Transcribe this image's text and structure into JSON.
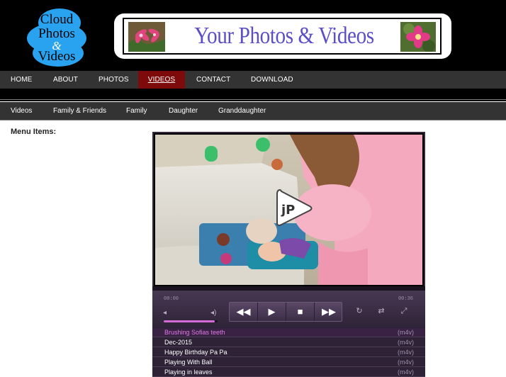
{
  "logo": {
    "line1": "Cloud",
    "line2": "Photos",
    "amp": "&",
    "line3": "Videos"
  },
  "banner": {
    "title": "Your Photos & Videos"
  },
  "nav": {
    "items": [
      "HOME",
      "ABOUT",
      "PHOTOS",
      "VIDEOS",
      "CONTACT",
      "DOWNLOAD"
    ],
    "active": "VIDEOS",
    "active_color": "#7d0b0b"
  },
  "subnav": {
    "items": [
      "Videos",
      "Family & Friends",
      "Family",
      "Daughter",
      "Granddaughter"
    ]
  },
  "menu_label": "Menu Items:",
  "player": {
    "watermark": "jP",
    "time_current": "00:00",
    "time_total": "00:36",
    "volume_level": 0.95,
    "accent_color": "#e07ae6",
    "controls": [
      "rewind-icon",
      "play-icon",
      "stop-icon",
      "fast-forward-icon"
    ],
    "extras": [
      "repeat-icon",
      "shuffle-icon",
      "fullscreen-icon"
    ],
    "playlist": [
      {
        "title": "Brushing Sofias teeth",
        "ext": "(m4v)",
        "active": true
      },
      {
        "title": "Dec-2015",
        "ext": "(m4v)"
      },
      {
        "title": "Happy Birthday Pa Pa",
        "ext": "(m4v)"
      },
      {
        "title": "Playing With Ball",
        "ext": "(m4v)"
      },
      {
        "title": "Playing in leaves",
        "ext": "(m4v)"
      }
    ]
  }
}
